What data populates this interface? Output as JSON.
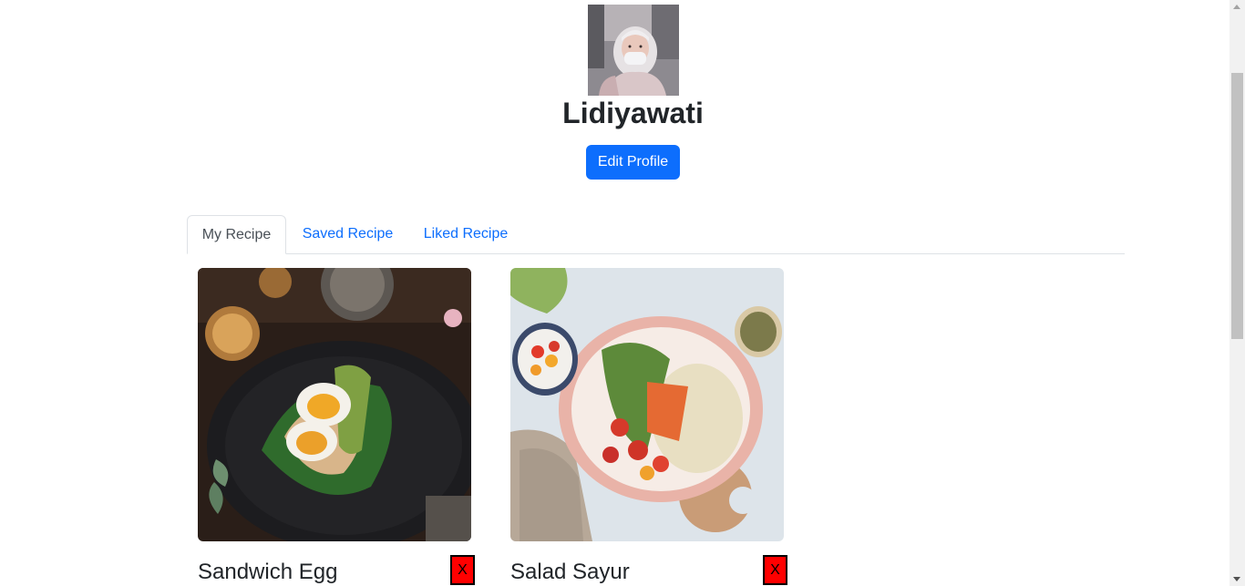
{
  "profile": {
    "name": "Lidiyawati",
    "edit_button_label": "Edit Profile"
  },
  "tabs": [
    {
      "label": "My Recipe",
      "active": true
    },
    {
      "label": "Saved Recipe",
      "active": false
    },
    {
      "label": "Liked Recipe",
      "active": false
    }
  ],
  "recipes": [
    {
      "title": "Sandwich Egg",
      "delete_label": "X"
    },
    {
      "title": "Salad Sayur",
      "delete_label": "X"
    }
  ],
  "colors": {
    "primary": "#0d6efd",
    "delete": "#ff0000",
    "text": "#212529",
    "tab_border": "#dee2e6"
  }
}
